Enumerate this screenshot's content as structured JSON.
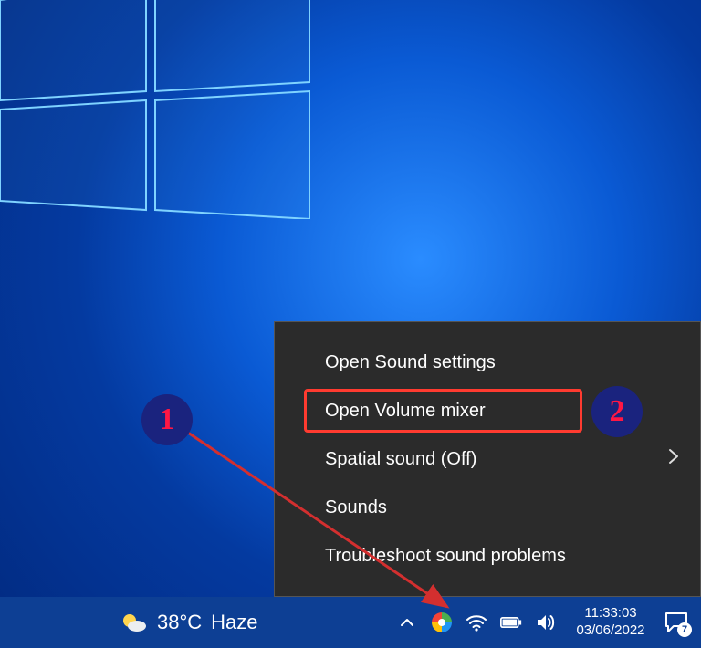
{
  "context_menu": {
    "items": [
      {
        "label": "Open Sound settings",
        "has_submenu": false
      },
      {
        "label": "Open Volume mixer",
        "has_submenu": false
      },
      {
        "label": "Spatial sound (Off)",
        "has_submenu": true
      },
      {
        "label": "Sounds",
        "has_submenu": false
      },
      {
        "label": "Troubleshoot sound problems",
        "has_submenu": false
      }
    ]
  },
  "taskbar": {
    "weather": {
      "temp": "38°C",
      "condition": "Haze"
    },
    "clock": {
      "time": "11:33:03",
      "date": "03/06/2022"
    },
    "action_center_badge": "7"
  },
  "annotations": {
    "step1": "1",
    "step2": "2"
  }
}
